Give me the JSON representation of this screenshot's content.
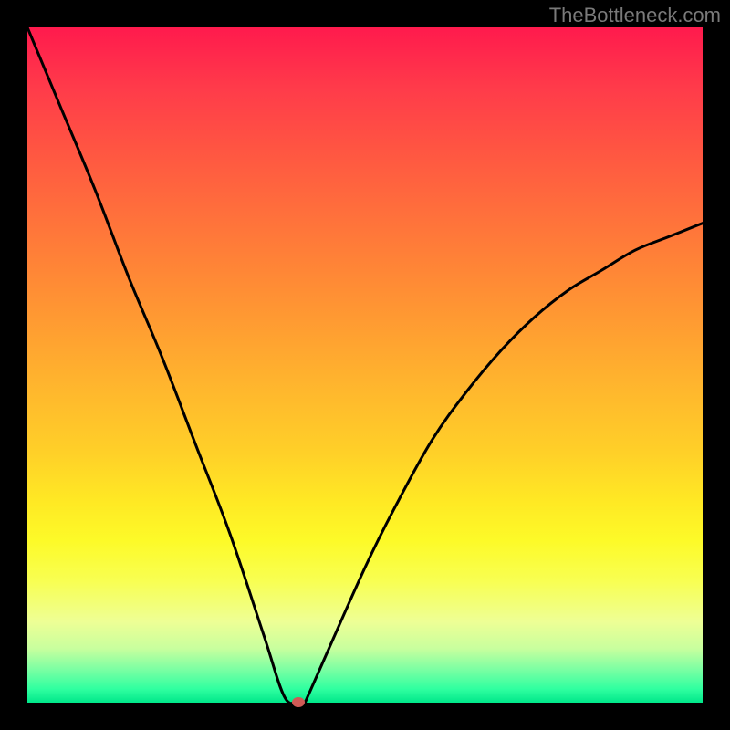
{
  "watermark": "TheBottleneck.com",
  "colors": {
    "frame": "#000000",
    "dot": "#cf5a56",
    "curve": "#000000"
  },
  "chart_data": {
    "type": "line",
    "title": "",
    "xlabel": "",
    "ylabel": "",
    "xlim": [
      0,
      100
    ],
    "ylim": [
      0,
      100
    ],
    "grid": false,
    "series": [
      {
        "name": "bottleneck-curve",
        "x": [
          0,
          5,
          10,
          15,
          20,
          25,
          30,
          35,
          38,
          40,
          41,
          42,
          50,
          55,
          60,
          65,
          70,
          75,
          80,
          85,
          90,
          95,
          100
        ],
        "values": [
          100,
          88,
          76,
          63,
          51,
          38,
          25,
          10,
          1,
          0,
          0,
          2,
          20,
          30,
          39,
          46,
          52,
          57,
          61,
          64,
          67,
          69,
          71
        ]
      }
    ],
    "ideal_point": {
      "x": 40.2,
      "y": 0
    },
    "gradient_stops": [
      {
        "pos": 0,
        "color": "#ff1a4d"
      },
      {
        "pos": 45,
        "color": "#ff9f31"
      },
      {
        "pos": 76,
        "color": "#fdfa28"
      },
      {
        "pos": 100,
        "color": "#00e78a"
      }
    ]
  }
}
